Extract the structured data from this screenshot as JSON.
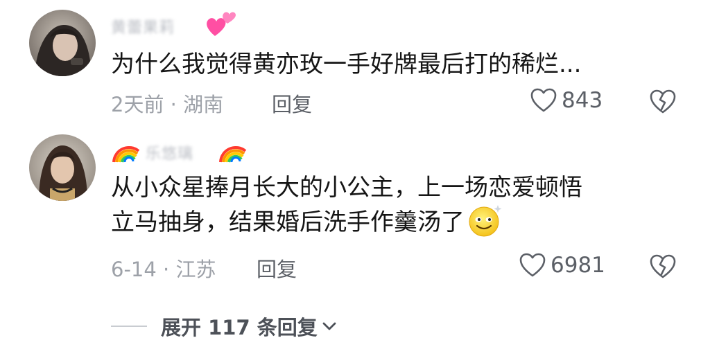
{
  "comments": [
    {
      "username": "黄蕾果莉",
      "text_lines": [
        "为什么我觉得黄亦玫一手好牌最后打的稀烂..."
      ],
      "time": "2天前",
      "location": "湖南",
      "reply_label": "回复",
      "likes": "843",
      "badge_icon": "pink-hearts-icon"
    },
    {
      "username": "乐悠璃",
      "text_lines": [
        "从小众星捧月长大的小公主，上一场恋爱顿悟",
        "立马抽身，结果婚后洗手作羹汤了"
      ],
      "time": "6-14",
      "location": "江苏",
      "reply_label": "回复",
      "likes": "6981",
      "badge_icon": "rainbow-icon"
    }
  ],
  "expand": {
    "label": "展开 117 条回复"
  },
  "colors": {
    "text": "#151515",
    "meta": "#9da1a8",
    "action": "#5b5f66",
    "username": "#b9bcc3"
  }
}
